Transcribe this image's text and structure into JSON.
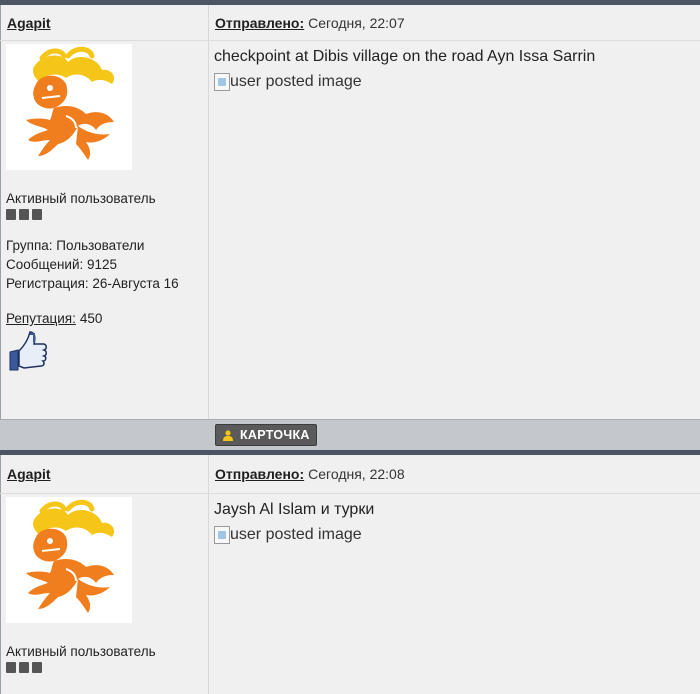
{
  "posts": [
    {
      "author": "Agapit",
      "sent_label": "Отправлено:",
      "sent_value": "Сегодня, 22:07",
      "rank": "Активный пользователь",
      "group": "Группа: Пользователи",
      "messages": "Сообщений: 9125",
      "registration": "Регистрация: 26-Августа 16",
      "reputation_label": "Репутация:",
      "reputation_value": "450",
      "text": "checkpoint at Dibis village on the road Ayn Issa Sarrin",
      "image_alt": "user posted image",
      "card_button": "КАРТОЧКА"
    },
    {
      "author": "Agapit",
      "sent_label": "Отправлено:",
      "sent_value": "Сегодня, 22:08",
      "rank": "Активный пользователь",
      "text": "Jaysh Al Islam и турки",
      "image_alt": "user posted image"
    }
  ],
  "colors": {
    "avatar_orange": "#f07e1e",
    "avatar_yellow": "#f5c518",
    "header_bar": "#4b5563",
    "footer_bar": "#c4c8cd"
  },
  "icons": {
    "reputation": "thumbs-up-icon",
    "card": "user-card-icon",
    "broken_image": "broken-image-icon"
  }
}
